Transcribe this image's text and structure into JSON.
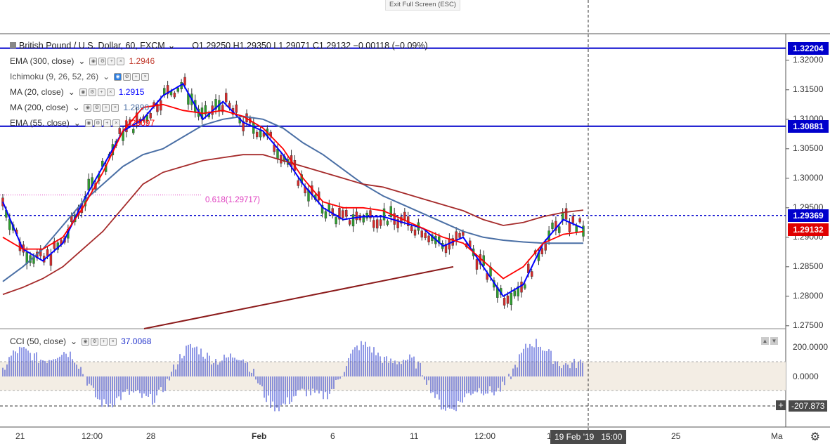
{
  "toolbar": {
    "exit_fullscreen": "Exit Full Screen (ESC)"
  },
  "symbol": {
    "name": "British Pound / U.S. Dollar, 60, FXCM",
    "ohlc": "O1.29250  H1.29350  L1.29071  C1.29132  −0.00118 (−0.09%)"
  },
  "indicators": [
    {
      "label": "EMA (300, close)",
      "value": "1.2946",
      "color": "#c0392b"
    },
    {
      "label": "Ichimoku (9, 26, 52, 26)",
      "value": "",
      "color": "#333333"
    },
    {
      "label": "MA (20, close)",
      "value": "1.2915",
      "color": "#0000ff"
    },
    {
      "label": "MA (200, close)",
      "value": "1.2890",
      "color": "#4a6fa5"
    },
    {
      "label": "EMA (55, close)",
      "value": "1.29097",
      "color": "#ff0000"
    }
  ],
  "fib_label": "0.618(1.29717)",
  "price_axis": {
    "ticks": [
      "1.32000",
      "1.31500",
      "1.31000",
      "1.30500",
      "1.30000",
      "1.29500",
      "1.29000",
      "1.28500",
      "1.28000",
      "1.27500"
    ],
    "tags": [
      {
        "name": "resistance-1",
        "text": "1.32204",
        "color": "#0000cc"
      },
      {
        "name": "resistance-2",
        "text": "1.30881",
        "color": "#0000cc"
      },
      {
        "name": "level-dotted",
        "text": "1.29369",
        "color": "#0000cc"
      },
      {
        "name": "last-price",
        "text": "1.29132",
        "color": "#e00000"
      }
    ]
  },
  "cci": {
    "label": "CCI (50, close)",
    "value": "37.0068",
    "ticks": [
      "200.0000",
      "0.0000"
    ],
    "cursor_value": "-207.873"
  },
  "time_axis": {
    "ticks": [
      "21",
      "12:00",
      "28",
      "Feb",
      "6",
      "11",
      "12:00",
      "18",
      "25",
      "Ma"
    ],
    "tooltip_date": "19 Feb '19",
    "tooltip_time": "15:00"
  },
  "chart_data": {
    "type": "line",
    "title": "British Pound / U.S. Dollar, 60, FXCM",
    "ylim": [
      1.2745,
      1.3245
    ],
    "levels": [
      1.32204,
      1.30881,
      1.29369
    ],
    "fib_618": 1.29717,
    "last_close": 1.29132,
    "series": [
      {
        "name": "MA (20, close)",
        "color": "#0000ff",
        "values": [
          1.296,
          1.288,
          1.286,
          1.289,
          1.296,
          1.302,
          1.308,
          1.31,
          1.314,
          1.316,
          1.31,
          1.313,
          1.3095,
          1.308,
          1.304,
          1.299,
          1.295,
          1.293,
          1.2935,
          1.2935,
          1.2925,
          1.2915,
          1.2885,
          1.29,
          1.285,
          1.28,
          1.282,
          1.289,
          1.293,
          1.2915
        ]
      },
      {
        "name": "MA (200, close)",
        "color": "#4a6fa5",
        "values": [
          1.2825,
          1.285,
          1.288,
          1.292,
          1.296,
          1.299,
          1.302,
          1.304,
          1.305,
          1.307,
          1.309,
          1.31,
          1.3105,
          1.31,
          1.3085,
          1.306,
          1.304,
          1.3015,
          1.299,
          1.297,
          1.2955,
          1.294,
          1.2925,
          1.291,
          1.29,
          1.2895,
          1.2892,
          1.289,
          1.289,
          1.289
        ]
      },
      {
        "name": "EMA (300, close)",
        "color": "#a52a2a",
        "values": [
          1.2803,
          1.2815,
          1.283,
          1.285,
          1.288,
          1.291,
          1.295,
          1.299,
          1.301,
          1.302,
          1.303,
          1.3035,
          1.304,
          1.304,
          1.303,
          1.302,
          1.301,
          1.3,
          1.299,
          1.2985,
          1.2975,
          1.2965,
          1.2955,
          1.2945,
          1.293,
          1.292,
          1.2925,
          1.2935,
          1.2942,
          1.2946
        ]
      },
      {
        "name": "EMA (55, close)",
        "color": "#ff0000",
        "values": [
          1.29,
          1.288,
          1.288,
          1.29,
          1.295,
          1.301,
          1.308,
          1.312,
          1.3125,
          1.3115,
          1.311,
          1.3115,
          1.3105,
          1.3085,
          1.305,
          1.3,
          1.296,
          1.295,
          1.295,
          1.2945,
          1.293,
          1.2915,
          1.29,
          1.289,
          1.286,
          1.283,
          1.285,
          1.289,
          1.2905,
          1.29097
        ]
      }
    ],
    "trendline": {
      "from": [
        1.2745
      ],
      "to": [
        1.285
      ]
    }
  }
}
